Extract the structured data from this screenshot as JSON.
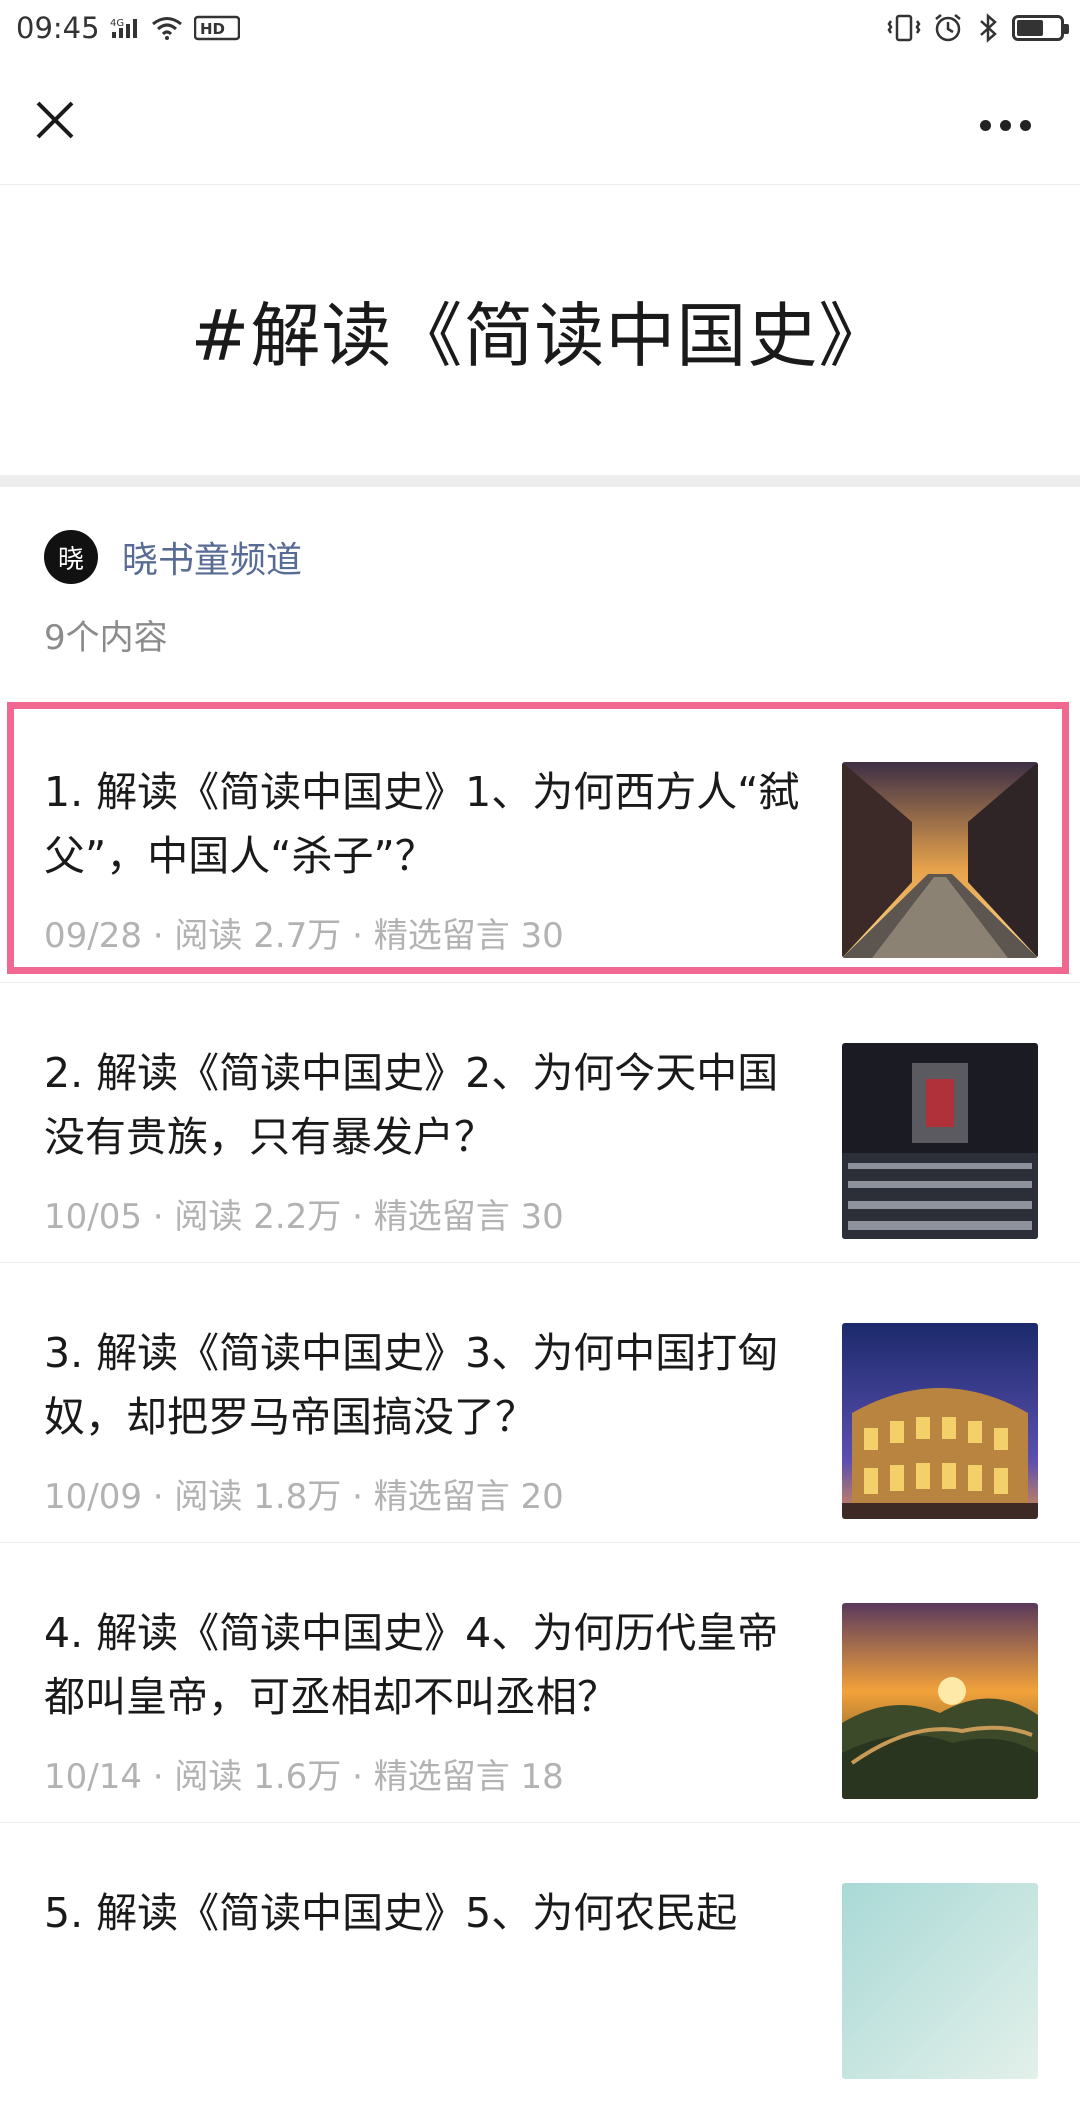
{
  "status_bar": {
    "time": "09:45",
    "network": "4G",
    "hd_label": "HD"
  },
  "header": {
    "close_icon": "close-icon",
    "more_icon": "more-icon"
  },
  "topic": {
    "title": "#解读《简读中国史》"
  },
  "author": {
    "avatar_text": "晓",
    "name": "晓书童频道",
    "content_count": "9个内容"
  },
  "articles": [
    {
      "title": "1. 解读《简读中国史》1、为何西方人“弑父”，中国人“杀子”？",
      "meta": "09/28 · 阅读 2.7万 · 精选留言 30",
      "thumb": "street-image",
      "highlighted": true
    },
    {
      "title": "2. 解读《简读中国史》2、为何今天中国没有贵族，只有暴发户？",
      "meta": "10/05 · 阅读 2.2万 · 精选留言 30",
      "thumb": "army-image"
    },
    {
      "title": "3. 解读《简读中国史》3、为何中国打匈奴，却把罗马帝国搞没了？",
      "meta": "10/09 · 阅读 1.8万 · 精选留言 20",
      "thumb": "colosseum-image"
    },
    {
      "title": "4. 解读《简读中国史》4、为何历代皇帝都叫皇帝，可丞相却不叫丞相？",
      "meta": "10/14 · 阅读 1.6万 · 精选留言 18",
      "thumb": "great-wall-image"
    },
    {
      "title": "5. 解读《简读中国史》5、为何农民起",
      "meta": "",
      "thumb": "sky-image"
    }
  ],
  "colors": {
    "highlight": "#f0678f",
    "author": "#576b95",
    "meta": "#b2b2b2"
  }
}
